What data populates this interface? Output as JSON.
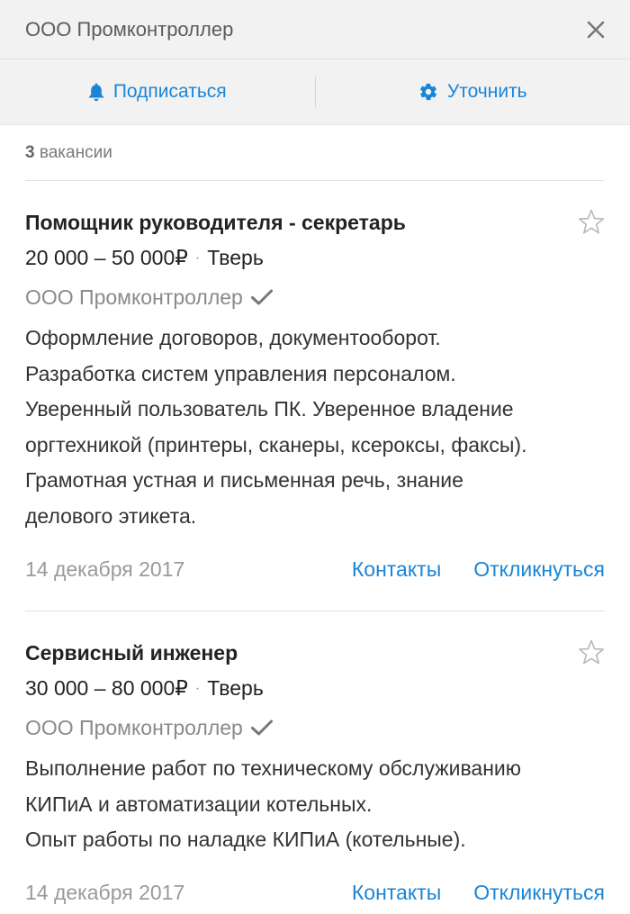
{
  "header": {
    "title": "ООО Промконтроллер",
    "close_icon": "close-icon"
  },
  "actions": {
    "subscribe_label": "Подписаться",
    "subscribe_icon": "bell-icon",
    "refine_label": "Уточнить",
    "refine_icon": "gear-icon"
  },
  "results": {
    "count_number": "3",
    "count_text": "вакансии"
  },
  "vacancies": [
    {
      "title": "Помощник руководителя - секретарь",
      "salary": "20 000 – 50 000₽",
      "separator": "·",
      "city": "Тверь",
      "company": "ООО Промконтроллер",
      "verified": true,
      "description": [
        "Оформление договоров, документооборот.",
        "Разработка систем управления персоналом.",
        "Уверенный пользователь ПК. Уверенное владение",
        "оргтехникой (принтеры, сканеры, ксероксы, факсы).",
        "Грамотная устная и письменная речь, знание",
        "делового этикета."
      ],
      "date": "14 декабря 2017",
      "contacts_label": "Контакты",
      "respond_label": "Откликнуться"
    },
    {
      "title": "Сервисный инженер",
      "salary": "30 000 – 80 000₽",
      "separator": "·",
      "city": "Тверь",
      "company": "ООО Промконтроллер",
      "verified": true,
      "description": [
        "Выполнение работ по техническому обслуживанию",
        "КИПиА и автоматизации котельных.",
        "Опыт работы по наладке КИПиА (котельные)."
      ],
      "date": "14 декабря 2017",
      "contacts_label": "Контакты",
      "respond_label": "Откликнуться"
    }
  ],
  "colors": {
    "accent": "#1a85d6",
    "header_bg": "#f2f2f2",
    "muted_text": "#8a8a8a"
  }
}
